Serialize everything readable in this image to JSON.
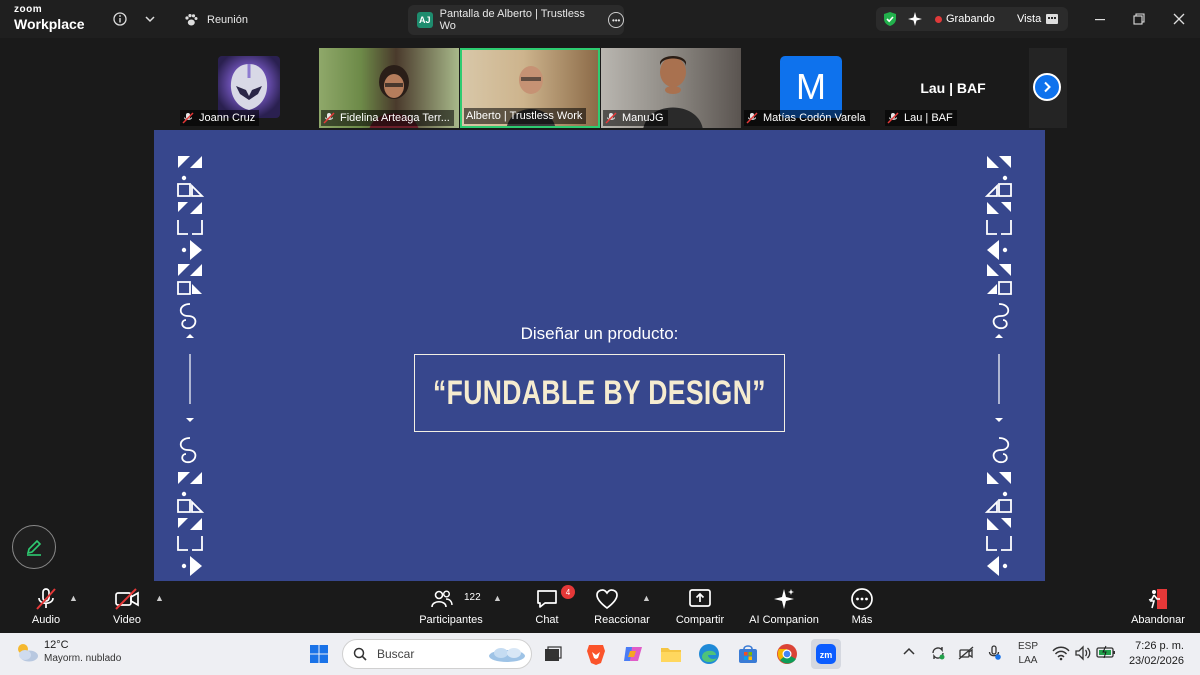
{
  "titlebar": {
    "brand_top": "zoom",
    "brand_bottom": "Workplace",
    "meeting_tab": "Reunión",
    "share_tab_badge": "AJ",
    "share_tab": "Pantalla de Alberto | Trustless Wo",
    "recording_label": "Grabando",
    "view_label": "Vista"
  },
  "participants": [
    {
      "name": "Joann Cruz"
    },
    {
      "name": "Fidelina Arteaga Terr..."
    },
    {
      "name": "Alberto | Trustless Work"
    },
    {
      "name": "ManuJG"
    },
    {
      "name": "Matías Codón Varela",
      "avatar_letter": "M"
    },
    {
      "name": "Lau | BAF",
      "display": "Lau | BAF"
    }
  ],
  "slide": {
    "subtitle": "Diseñar un producto:",
    "title": "“FUNDABLE BY DESIGN”"
  },
  "toolbar": {
    "audio": "Audio",
    "video": "Video",
    "participants": "Participantes",
    "participants_count": "122",
    "chat": "Chat",
    "chat_badge": "4",
    "react": "Reaccionar",
    "share": "Compartir",
    "ai": "AI Companion",
    "more": "Más",
    "leave": "Abandonar"
  },
  "taskbar": {
    "temp": "12°C",
    "weather": "Mayorm. nublado",
    "search_placeholder": "Buscar",
    "lang_top": "ESP",
    "lang_bottom": "LAA",
    "time": "7:26 p. m.",
    "date": "23/02/2026"
  },
  "colors": {
    "slide_bg": "#37478d",
    "slide_title": "#f6ecd0",
    "active_speaker": "#2ecc71",
    "zoom_blue": "#0e72ed",
    "recording_red": "#e03a3a"
  }
}
